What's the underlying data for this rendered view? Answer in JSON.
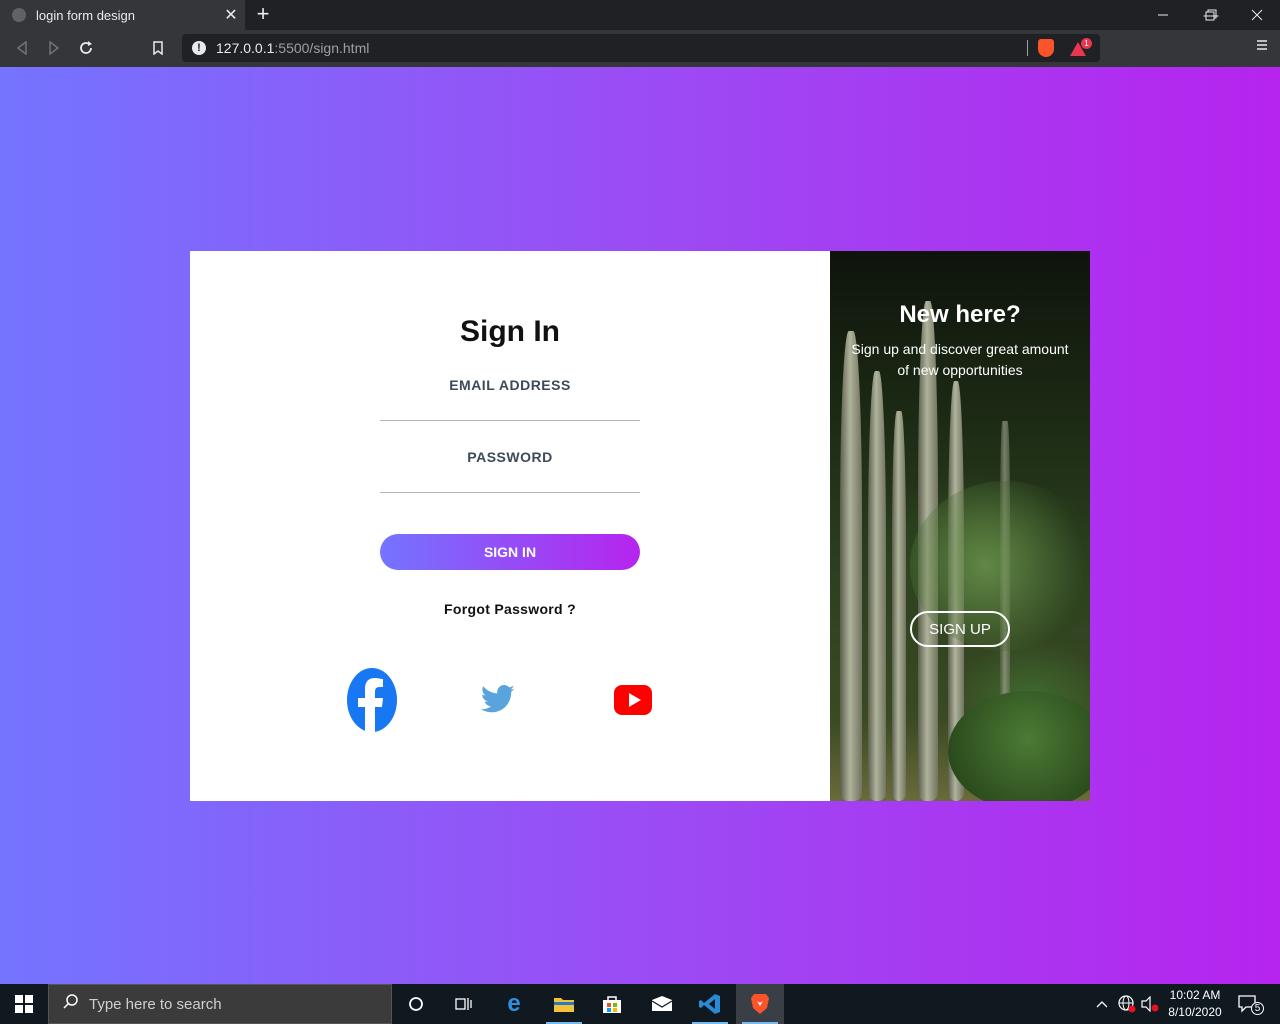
{
  "browser": {
    "tab_title": "login form design",
    "tab_close": "✕",
    "new_tab": "+",
    "url_host": "127.0.0.1",
    "url_path": ":5500/sign.html",
    "rewards_badge": "1",
    "window_controls": {
      "minimize": "—",
      "restore": "❐",
      "close": "✕"
    }
  },
  "signin": {
    "title": "Sign In",
    "email_label": "EMAIL ADDRESS",
    "email_value": "",
    "password_label": "PASSWORD",
    "password_value": "",
    "button_label": "SIGN IN",
    "forgot_label": "Forgot Password ?",
    "social": [
      {
        "name": "facebook-icon",
        "color": "#1877f2"
      },
      {
        "name": "twitter-icon",
        "color": "#5aa4de"
      },
      {
        "name": "youtube-icon",
        "color": "#ff0000"
      }
    ]
  },
  "signup_panel": {
    "title": "New here?",
    "text": "Sign up and discover great amount of new opportunities",
    "button_label": "SIGN UP"
  },
  "taskbar": {
    "search_placeholder": "Type here to search",
    "time": "10:02 AM",
    "date": "8/10/2020",
    "notifications_count": "5"
  },
  "colors": {
    "gradient_start": "#7474ff",
    "gradient_end": "#b624ee",
    "brave_orange": "#fb542b"
  }
}
